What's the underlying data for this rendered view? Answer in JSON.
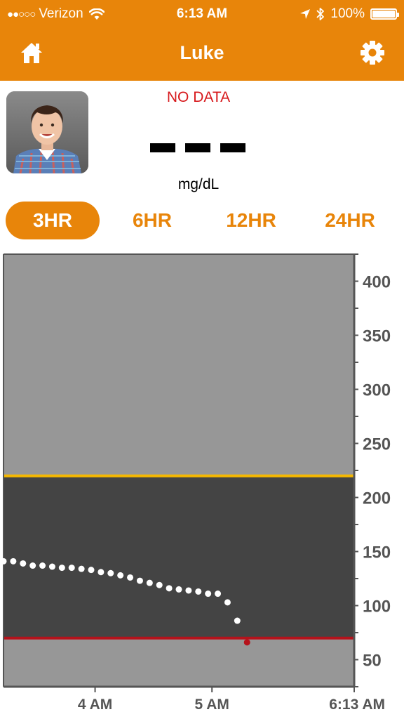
{
  "status_bar": {
    "signal_dots": "●●○○○",
    "carrier": "Verizon",
    "wifi_icon": "wifi-icon",
    "time": "6:13 AM",
    "location_icon": "location-arrow-icon",
    "bluetooth_icon": "bluetooth-icon",
    "battery_percent": "100%",
    "battery_level": 1.0
  },
  "header": {
    "title": "Luke",
    "home_icon": "home-icon",
    "settings_icon": "gear-icon",
    "background_color": "#e8850a"
  },
  "reading": {
    "status": "NO DATA",
    "value": "– – –",
    "units": "mg/dL",
    "status_color": "#d7191c"
  },
  "tabs": [
    {
      "label": "3HR",
      "active": true
    },
    {
      "label": "6HR",
      "active": false
    },
    {
      "label": "12HR",
      "active": false
    },
    {
      "label": "24HR",
      "active": false
    }
  ],
  "chart_data": {
    "type": "scatter",
    "title": "",
    "xlabel": "",
    "ylabel": "",
    "ylim": [
      25,
      425
    ],
    "y_ticks": [
      50,
      100,
      150,
      200,
      250,
      300,
      350,
      400
    ],
    "xlim": [
      "3:13 AM",
      "6:13 AM"
    ],
    "x_ticks": [
      "4 AM",
      "5 AM",
      "6:13 AM"
    ],
    "high_threshold": 220,
    "low_threshold": 70,
    "colors": {
      "high_line": "#f5b800",
      "low_line": "#b5121b",
      "in_range_band": "#444444",
      "out_of_range_band": "#979797",
      "point": "#ffffff",
      "low_point": "#b5121b"
    },
    "points": [
      {
        "t": "3:13 AM",
        "y": 141
      },
      {
        "t": "3:18 AM",
        "y": 141
      },
      {
        "t": "3:23 AM",
        "y": 139
      },
      {
        "t": "3:28 AM",
        "y": 137
      },
      {
        "t": "3:33 AM",
        "y": 137
      },
      {
        "t": "3:38 AM",
        "y": 136
      },
      {
        "t": "3:43 AM",
        "y": 135
      },
      {
        "t": "3:48 AM",
        "y": 135
      },
      {
        "t": "3:53 AM",
        "y": 134
      },
      {
        "t": "3:58 AM",
        "y": 133
      },
      {
        "t": "4:03 AM",
        "y": 131
      },
      {
        "t": "4:08 AM",
        "y": 130
      },
      {
        "t": "4:13 AM",
        "y": 128
      },
      {
        "t": "4:18 AM",
        "y": 126
      },
      {
        "t": "4:23 AM",
        "y": 123
      },
      {
        "t": "4:28 AM",
        "y": 121
      },
      {
        "t": "4:33 AM",
        "y": 119
      },
      {
        "t": "4:38 AM",
        "y": 116
      },
      {
        "t": "4:43 AM",
        "y": 115
      },
      {
        "t": "4:48 AM",
        "y": 114
      },
      {
        "t": "4:53 AM",
        "y": 113
      },
      {
        "t": "4:58 AM",
        "y": 111
      },
      {
        "t": "5:03 AM",
        "y": 111
      },
      {
        "t": "5:08 AM",
        "y": 103
      },
      {
        "t": "5:13 AM",
        "y": 86
      },
      {
        "t": "5:18 AM",
        "y": 66,
        "low": true
      }
    ]
  }
}
